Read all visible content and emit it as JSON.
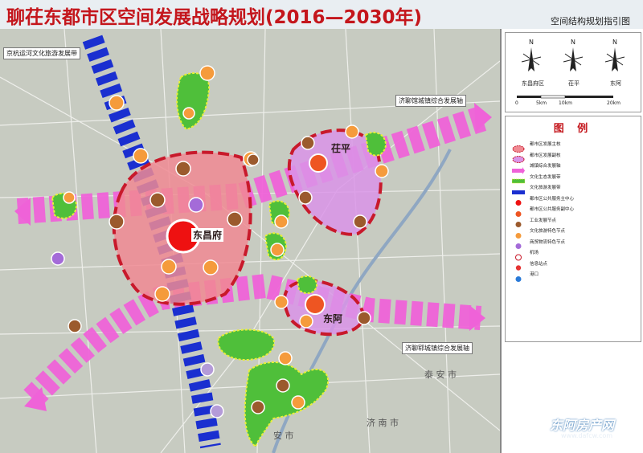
{
  "title": "聊茌东都市区空间发展战略规划(2016—2030年)",
  "subtitle": "空间结构规划指引图",
  "axes": {
    "canal": "京杭运河文化旅游发展带",
    "north": "济聊馆城镇综合发展轴",
    "south": "济聊郓城镇综合发展轴"
  },
  "cities": {
    "main": "东昌府",
    "north": "茌平",
    "east": "东阿"
  },
  "places": {
    "tai_an": "泰 安 市",
    "ji_nan": "济 南 市",
    "an": "安 市"
  },
  "compass": {
    "n": "N",
    "labels": [
      "东昌府区",
      "茌平",
      "东阿"
    ],
    "scale": [
      "0",
      "5km",
      "10km",
      "20km"
    ]
  },
  "legend": {
    "title": "图 例",
    "items": [
      {
        "symbol": "main-area",
        "label": "都市区发展主核"
      },
      {
        "symbol": "sub-area",
        "label": "都市区发展副核"
      },
      {
        "symbol": "town-axis",
        "label": "城镇综合发展轴"
      },
      {
        "symbol": "eco-corridor",
        "label": "文化生态发展带"
      },
      {
        "symbol": "culture-belt",
        "label": "文化旅游发展带"
      },
      {
        "symbol": "red-dot",
        "label": "都市区公共服务主中心"
      },
      {
        "symbol": "orange-red-dot",
        "label": "都市区公共服务副中心"
      },
      {
        "symbol": "brown-dot",
        "label": "工业发展节点"
      },
      {
        "symbol": "orange-dot",
        "label": "文化旅游特色节点"
      },
      {
        "symbol": "purple-dot",
        "label": "商贸物流特色节点"
      },
      {
        "symbol": "airport",
        "label": "机场"
      },
      {
        "symbol": "hub",
        "label": "信息站点"
      },
      {
        "symbol": "port",
        "label": "港口"
      }
    ]
  },
  "watermark": {
    "text": "东阿房产网",
    "url": "www.dafcw.com"
  },
  "colors": {
    "title_red": "#c4161c",
    "main_core": "#f08a93",
    "sub_core": "#d994e8",
    "axis_pink": "#ef62d8",
    "canal_blue": "#1a2fd0",
    "green": "#4fbf3a",
    "center_red": "#ee1111",
    "orange": "#f59b3c",
    "brown": "#9b5a2d",
    "purple": "#a46bd8"
  }
}
